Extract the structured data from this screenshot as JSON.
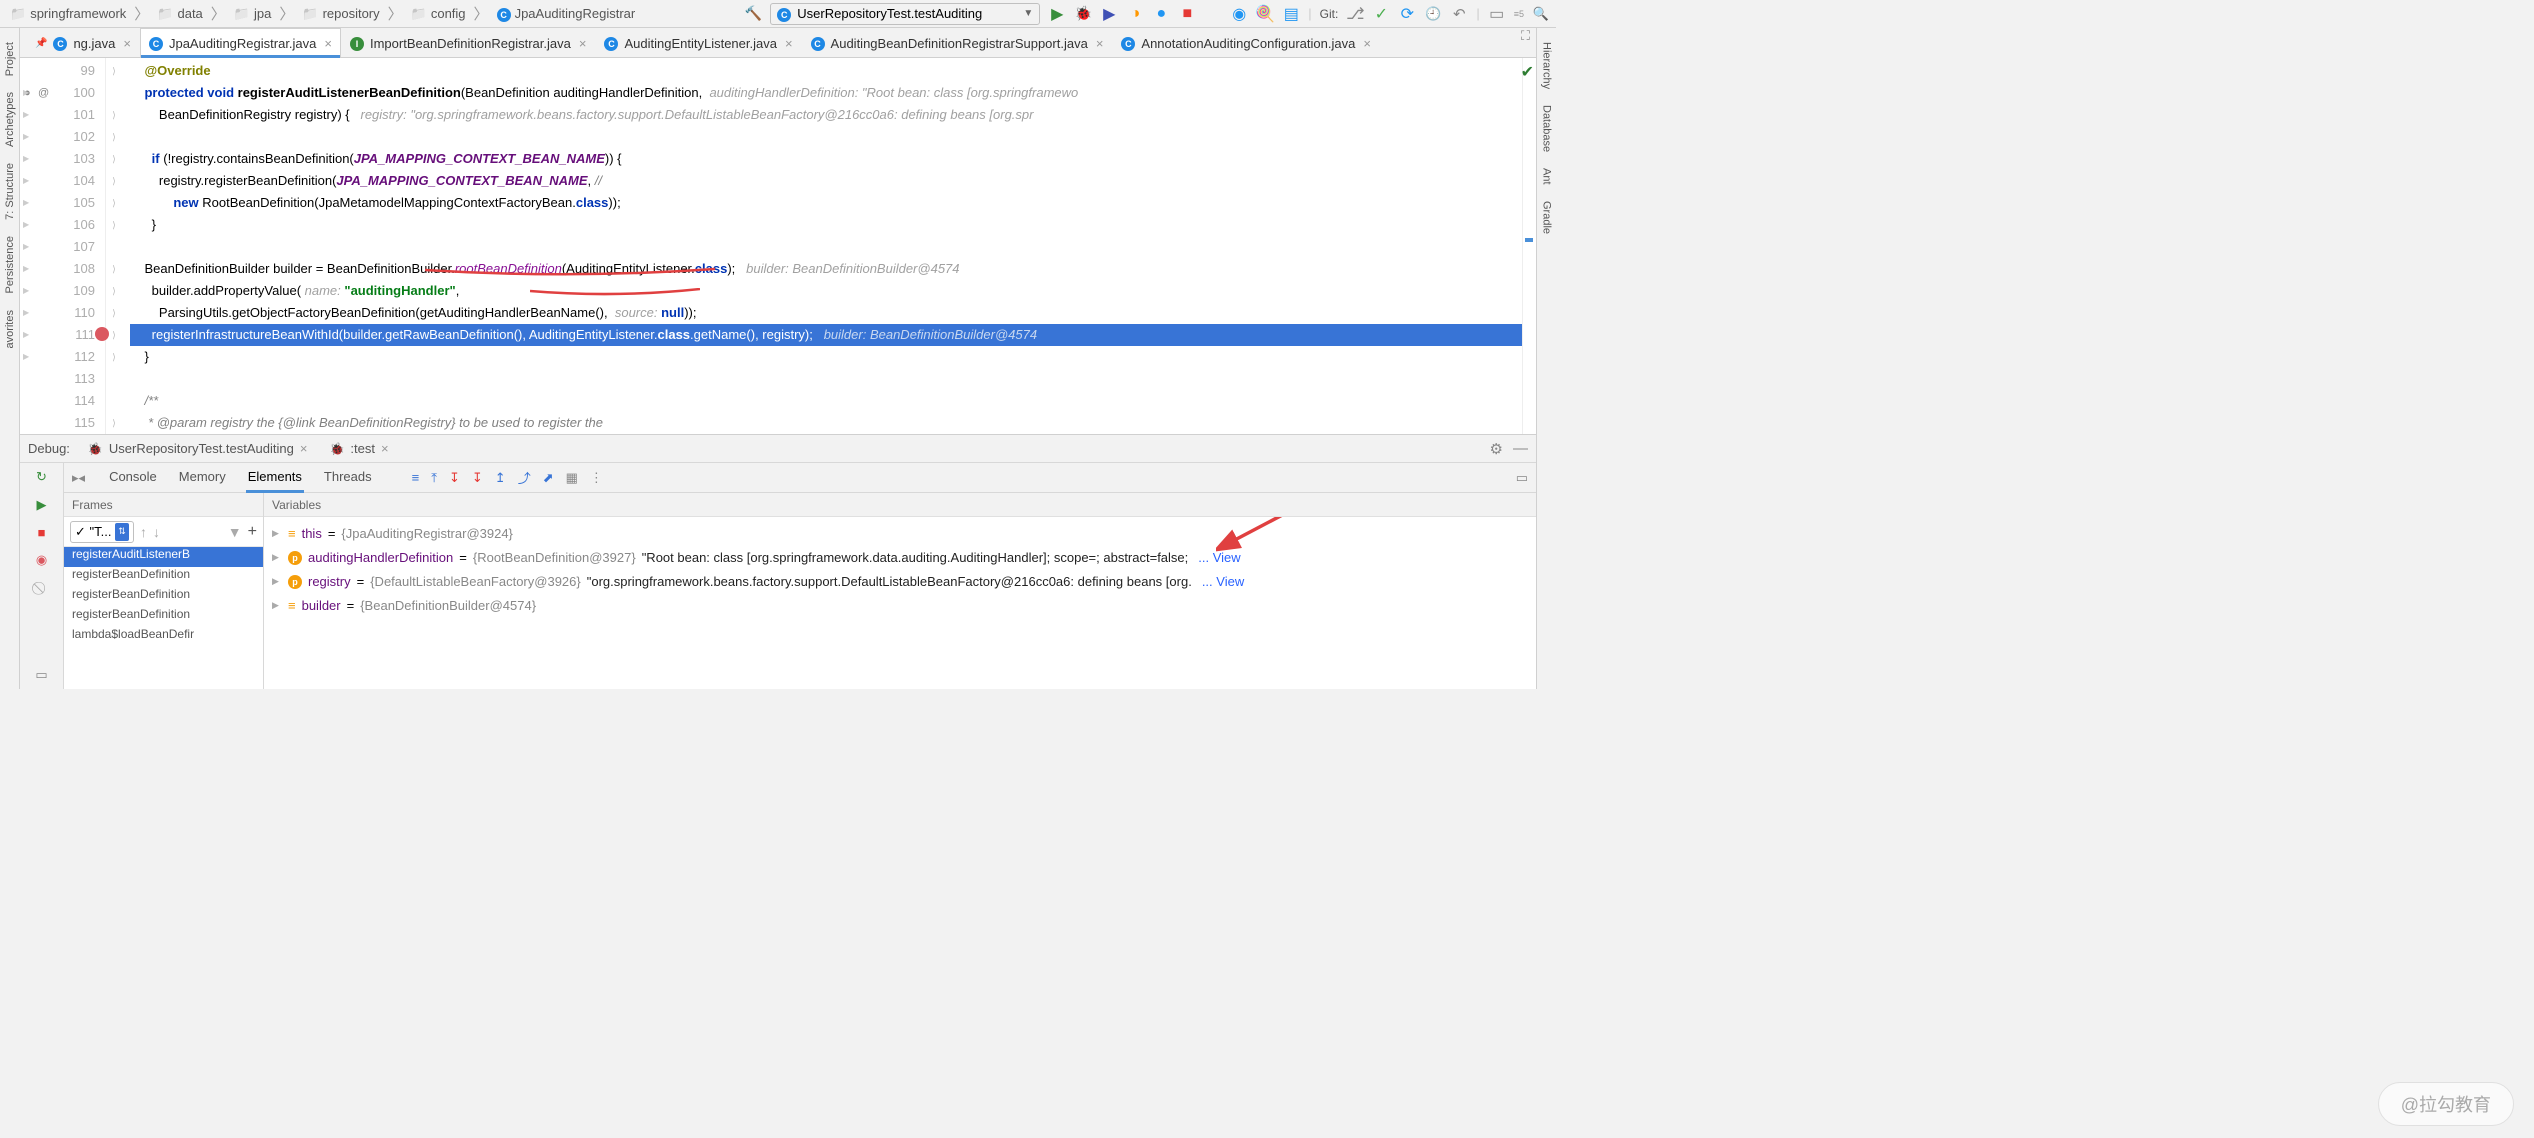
{
  "breadcrumbs": [
    "springframework",
    "data",
    "jpa",
    "repository",
    "config",
    "JpaAuditingRegistrar"
  ],
  "run_config": "UserRepositoryTest.testAuditing",
  "git_label": "Git:",
  "side_left": [
    "Project",
    "Archetypes",
    "7: Structure",
    "Persistence",
    "avorites"
  ],
  "side_right": [
    "Hierarchy",
    "Database",
    "Ant",
    "Gradle"
  ],
  "editor_tabs": [
    {
      "label": "ng.java",
      "icon": "class",
      "active": false,
      "pin": true
    },
    {
      "label": "JpaAuditingRegistrar.java",
      "icon": "class",
      "active": true
    },
    {
      "label": "ImportBeanDefinitionRegistrar.java",
      "icon": "interface",
      "active": false
    },
    {
      "label": "AuditingEntityListener.java",
      "icon": "class",
      "active": false
    },
    {
      "label": "AuditingBeanDefinitionRegistrarSupport.java",
      "icon": "class",
      "active": false
    },
    {
      "label": "AnnotationAuditingConfiguration.java",
      "icon": "class",
      "active": false
    }
  ],
  "lines": {
    "start": 99,
    "entries": [
      {
        "n": 99,
        "t": "@Override",
        "cls": "ann",
        "ind": 2,
        "fold": ">"
      },
      {
        "n": 100,
        "mark": "@",
        "t": "protected void ",
        "kw": true,
        "ind": 2,
        "rest": "registerAuditListenerBeanDefinition(BeanDefinition auditingHandlerDefinition,",
        "hint": "  auditingHandlerDefinition: \"Root bean: class [org.springframewo"
      },
      {
        "n": 101,
        "ind": 4,
        "t": "",
        "rest": "BeanDefinitionRegistry registry) {",
        "hint": "   registry: \"org.springframework.beans.factory.support.DefaultListableBeanFactory@216cc0a6: defining beans [org.spr",
        "fold": ">"
      },
      {
        "n": 102,
        "ind": 2,
        "t": "",
        "fold": ">"
      },
      {
        "n": 103,
        "ind": 3,
        "t": "if ",
        "kw": true,
        "rest": "(!registry.containsBeanDefinition(JPA_MAPPING_CONTEXT_BEAN_NAME)) {",
        "fold": ">"
      },
      {
        "n": 104,
        "ind": 4,
        "t": "",
        "rest": "registry.registerBeanDefinition(JPA_MAPPING_CONTEXT_BEAN_NAME, //",
        "fold": ">"
      },
      {
        "n": 105,
        "ind": 6,
        "t": "new ",
        "kw": true,
        "rest": "RootBeanDefinition(JpaMetamodelMappingContextFactoryBean.class));",
        "fold": ">"
      },
      {
        "n": 106,
        "ind": 3,
        "t": "}",
        "fold": ">"
      },
      {
        "n": 107,
        "ind": 2,
        "t": ""
      },
      {
        "n": 108,
        "ind": 2,
        "t": "",
        "rest": "BeanDefinitionBuilder builder = BeanDefinitionBuilder.rootBeanDefinition(AuditingEntityListener.class);",
        "hint": "   builder: BeanDefinitionBuilder@4574",
        "fold": ">"
      },
      {
        "n": 109,
        "ind": 3,
        "t": "",
        "rest": "builder.addPropertyValue( name: \"auditingHandler\",",
        "fold": ">"
      },
      {
        "n": 110,
        "ind": 4,
        "t": "",
        "rest": "ParsingUtils.getObjectFactoryBeanDefinition(getAuditingHandlerBeanName(),  source: null));",
        "fold": ">"
      },
      {
        "n": 111,
        "bp": true,
        "ind": 3,
        "cur": true,
        "t": "",
        "rest": "registerInfrastructureBeanWithId(builder.getRawBeanDefinition(), AuditingEntityListener.class.getName(), registry);",
        "hint": "   builder: BeanDefinitionBuilder@4574",
        "fold": ">"
      },
      {
        "n": 112,
        "ind": 2,
        "t": "}",
        "fold": ">"
      },
      {
        "n": 113,
        "ind": 2,
        "t": ""
      },
      {
        "n": 114,
        "ind": 2,
        "t": "/**",
        "cm": true
      },
      {
        "n": 115,
        "ind": 2,
        "t": "",
        "cm": true,
        "rest": " * @param registry the {@link BeanDefinitionRegistry} to be used to register the",
        "fold": ">"
      }
    ]
  },
  "debug": {
    "title": "Debug:",
    "sessions": [
      {
        "label": "UserRepositoryTest.testAuditing"
      },
      {
        "label": ":test",
        "active": true
      }
    ],
    "tabs": [
      "Console",
      "Memory",
      "Elements",
      "Threads"
    ],
    "active_tab": 2,
    "frames_title": "Frames",
    "vars_title": "Variables",
    "thread_sel": "✓ \"T...",
    "frames": [
      {
        "label": "registerAuditListenerB",
        "sel": true
      },
      {
        "label": "registerBeanDefinition"
      },
      {
        "label": "registerBeanDefinition"
      },
      {
        "label": "registerBeanDefinition"
      },
      {
        "label": "lambda$loadBeanDefir"
      }
    ],
    "vars": [
      {
        "icon": "field",
        "name": "this",
        "eq": " = ",
        "grey": "{JpaAuditingRegistrar@3924}"
      },
      {
        "icon": "param",
        "name": "auditingHandlerDefinition",
        "eq": " = ",
        "grey": "{RootBeanDefinition@3927} ",
        "val": "\"Root bean: class [org.springframework.data.auditing.AuditingHandler]; scope=; abstract=false;",
        "view": "... View"
      },
      {
        "icon": "param",
        "name": "registry",
        "eq": " = ",
        "grey": "{DefaultListableBeanFactory@3926} ",
        "val": "\"org.springframework.beans.factory.support.DefaultListableBeanFactory@216cc0a6: defining beans [org.",
        "view": "... View"
      },
      {
        "icon": "field",
        "name": "builder",
        "eq": " = ",
        "grey": "{BeanDefinitionBuilder@4574}"
      }
    ]
  },
  "watermark": "@拉勾教育"
}
